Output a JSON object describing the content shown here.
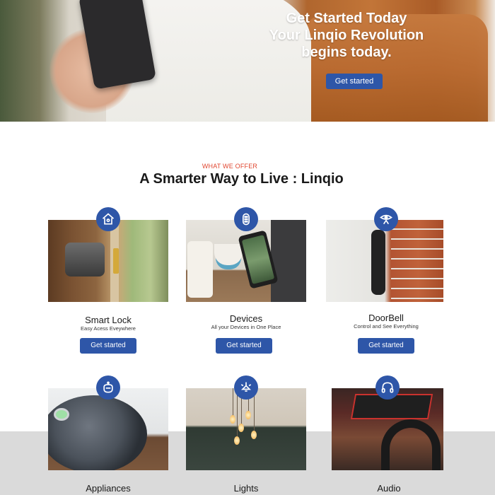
{
  "hero": {
    "line1": "Get Started Today",
    "line2": "Your Linqio Revolution",
    "line3": "begins today.",
    "cta_label": "Get started"
  },
  "section": {
    "eyebrow": "WHAT WE OFFER",
    "title": "A Smarter Way to Live : Linqio"
  },
  "cards": [
    {
      "title": "Smart Lock",
      "subtitle": "Easy Acess Eveywhere",
      "button": "Get started",
      "icon": "home-lock-icon"
    },
    {
      "title": "Devices",
      "subtitle": "All your Devices in One Place",
      "button": "Get started",
      "icon": "remote-control-icon"
    },
    {
      "title": "DoorBell",
      "subtitle": "Control and See Everything",
      "button": "Get started",
      "icon": "camera-eye-icon"
    },
    {
      "title": "Appliances",
      "subtitle": "",
      "button": "",
      "icon": "robot-vacuum-icon"
    },
    {
      "title": "Lights",
      "subtitle": "",
      "button": "",
      "icon": "lamp-icon"
    },
    {
      "title": "Audio",
      "subtitle": "",
      "button": "",
      "icon": "headphones-icon"
    }
  ],
  "colors": {
    "accent": "#2e56a8",
    "eyebrow": "#e0462f",
    "band": "#dadada"
  }
}
